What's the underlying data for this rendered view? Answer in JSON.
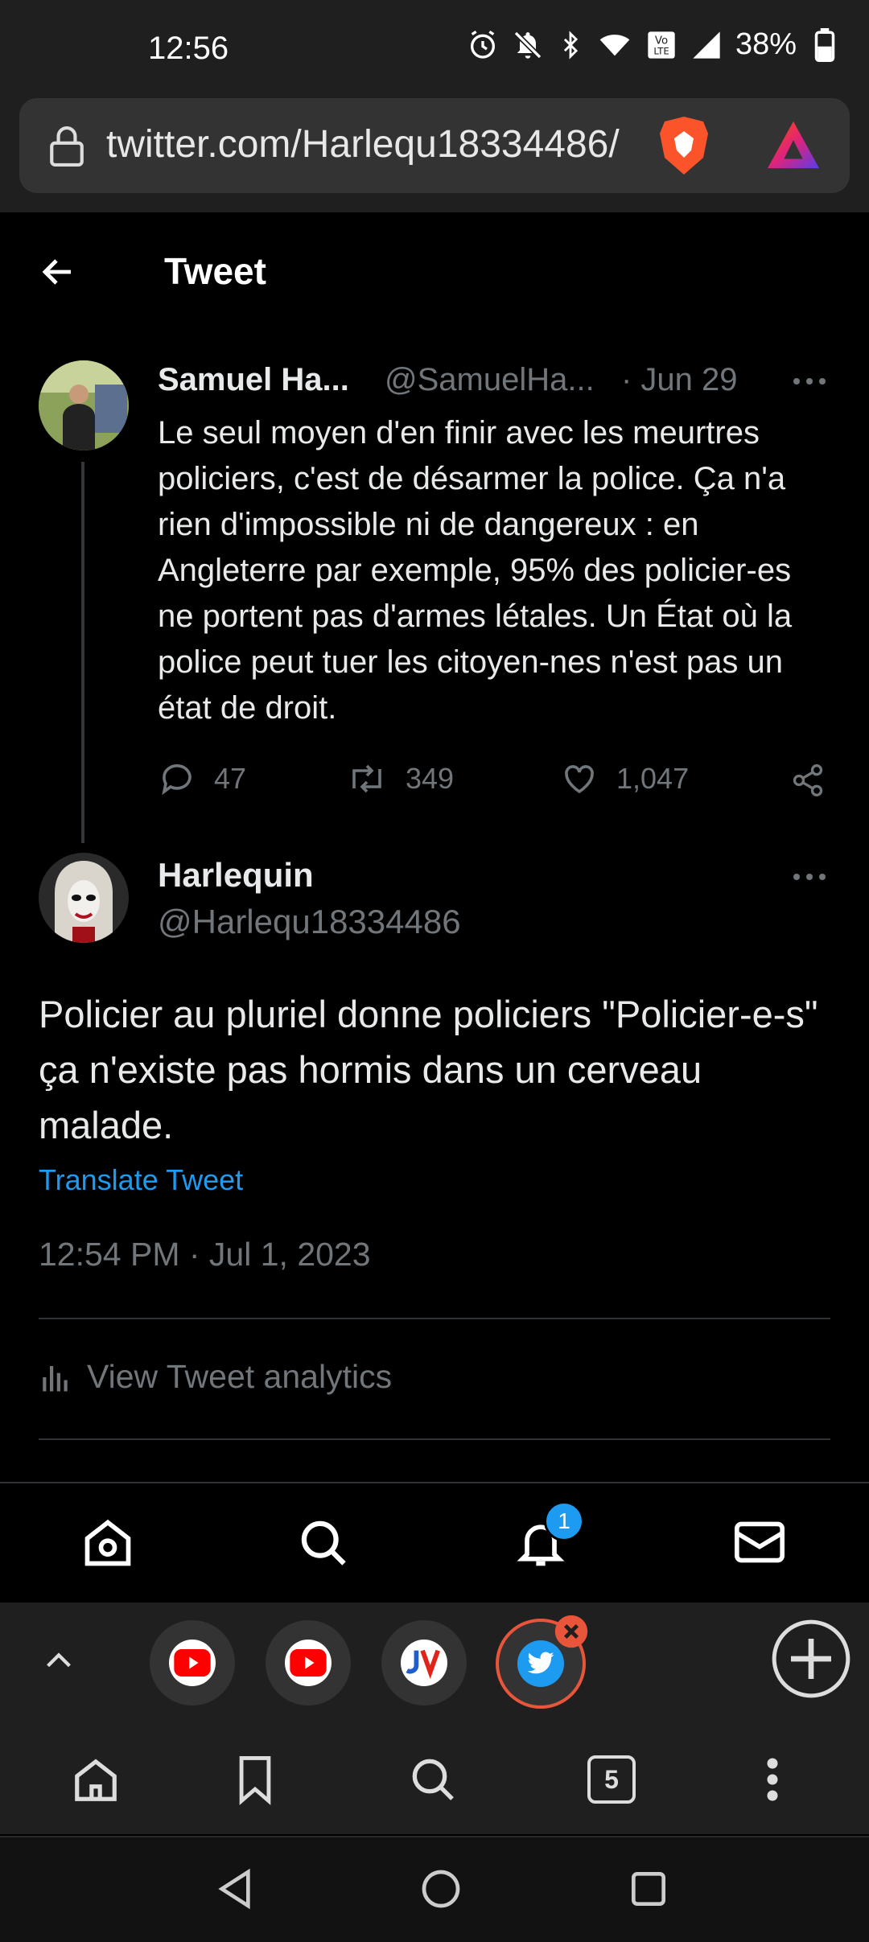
{
  "status_bar": {
    "time": "12:56",
    "battery": "38%"
  },
  "browser": {
    "url": "twitter.com/Harlequ18334486/",
    "tab_count": "5"
  },
  "header": {
    "title": "Tweet"
  },
  "tweet_parent": {
    "name": "Samuel Ha...",
    "handle": "@SamuelHa...",
    "date": "· Jun 29",
    "text": "Le seul moyen d'en finir avec les  meurtres policiers, c'est de désarmer la police. Ça n'a rien d'impossible ni de dangereux : en Angleterre par exemple, 95% des policier-es ne portent pas d'armes létales. Un État où la police peut tuer les citoyen-nes n'est pas un état de droit.",
    "replies": "47",
    "retweets": "349",
    "likes": "1,047"
  },
  "tweet_main": {
    "name": "Harlequin",
    "handle": "@Harlequ18334486",
    "text": "Policier au pluriel donne policiers \"Policier-e-s\" ça n'existe pas hormis dans un cerveau malade.",
    "translate": "Translate Tweet",
    "timestamp": "12:54 PM · Jul 1, 2023",
    "analytics": "View Tweet analytics"
  },
  "twitter_nav": {
    "notifications_badge": "1"
  },
  "colors": {
    "accent": "#1d9bf0",
    "brave_orange": "#fb542b",
    "youtube_red": "#ff0000"
  }
}
